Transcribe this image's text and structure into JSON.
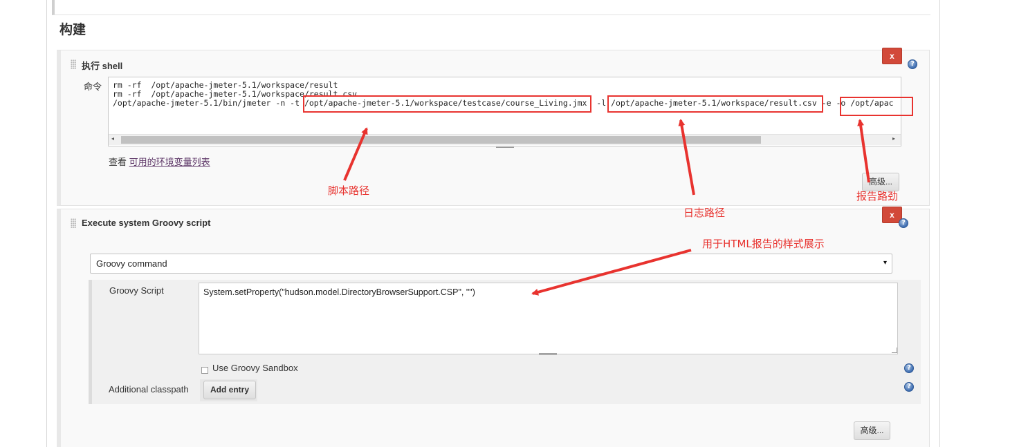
{
  "section": {
    "title": "构建"
  },
  "shell_step": {
    "title": "执行 shell",
    "delete_label": "x",
    "help_label": "?",
    "command_label": "命令",
    "command_lines": [
      "rm -rf  /opt/apache-jmeter-5.1/workspace/result",
      "rm -rf  /opt/apache-jmeter-5.1/workspace/result.csv",
      "/opt/apache-jmeter-5.1/bin/jmeter -n -t /opt/apache-jmeter-5.1/workspace/testcase/course_Living.jmx  -l /opt/apache-jmeter-5.1/workspace/result.csv -e -o /opt/apac"
    ],
    "scroll_left": "◂",
    "scroll_right": "▸",
    "env_prefix": "查看 ",
    "env_link": "可用的环境变量列表",
    "advanced_label": "高级..."
  },
  "groovy_step": {
    "title": "Execute system Groovy script",
    "delete_label": "x",
    "help_label": "?",
    "select_value": "Groovy command",
    "select_arrow": "▾",
    "script_label": "Groovy Script",
    "script_value": "System.setProperty(\"hudson.model.DirectoryBrowserSupport.CSP\", \"\")",
    "sandbox_label": "Use Groovy Sandbox",
    "classpath_label": "Additional classpath",
    "add_entry_label": "Add entry",
    "advanced_label": "高级..."
  },
  "annotations": {
    "script_path": "脚本路径",
    "log_path": "日志路径",
    "report_path": "报告路劲",
    "html_style": "用于HTML报告的样式展示",
    "color": "#e8332f"
  }
}
